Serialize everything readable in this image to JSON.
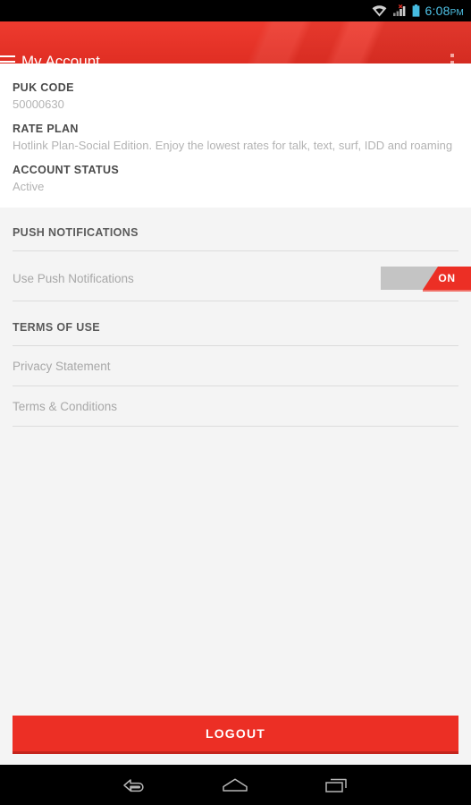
{
  "statusbar": {
    "time": "6:08",
    "ampm": "PM",
    "icons": [
      "wifi-icon",
      "signal-no-service-icon",
      "battery-icon"
    ]
  },
  "appbar": {
    "menu_icon": "hamburger-menu-icon",
    "title": "My Account",
    "overflow_icon": "overflow-menu-icon",
    "background_color": "#e8342a"
  },
  "account": {
    "fields": [
      {
        "label": "PUK CODE",
        "value": "50000630"
      },
      {
        "label": "RATE PLAN",
        "value": "Hotlink Plan-Social Edition. Enjoy the lowest rates for talk, text, surf, IDD and roaming"
      },
      {
        "label": "ACCOUNT STATUS",
        "value": "Active"
      }
    ]
  },
  "push_notifications": {
    "header": "PUSH NOTIFICATIONS",
    "row_label": "Use Push Notifications",
    "toggle_state": "ON",
    "toggle_on_color": "#ec2f25",
    "toggle_off_color": "#c4c4c4"
  },
  "terms_of_use": {
    "header": "TERMS OF USE",
    "items": [
      {
        "label": "Privacy Statement"
      },
      {
        "label": "Terms & Conditions"
      }
    ]
  },
  "logout": {
    "label": "LOGOUT",
    "color": "#ec2f25"
  },
  "navbar": {
    "back": "back-icon",
    "home": "home-icon",
    "recents": "recent-apps-icon"
  }
}
